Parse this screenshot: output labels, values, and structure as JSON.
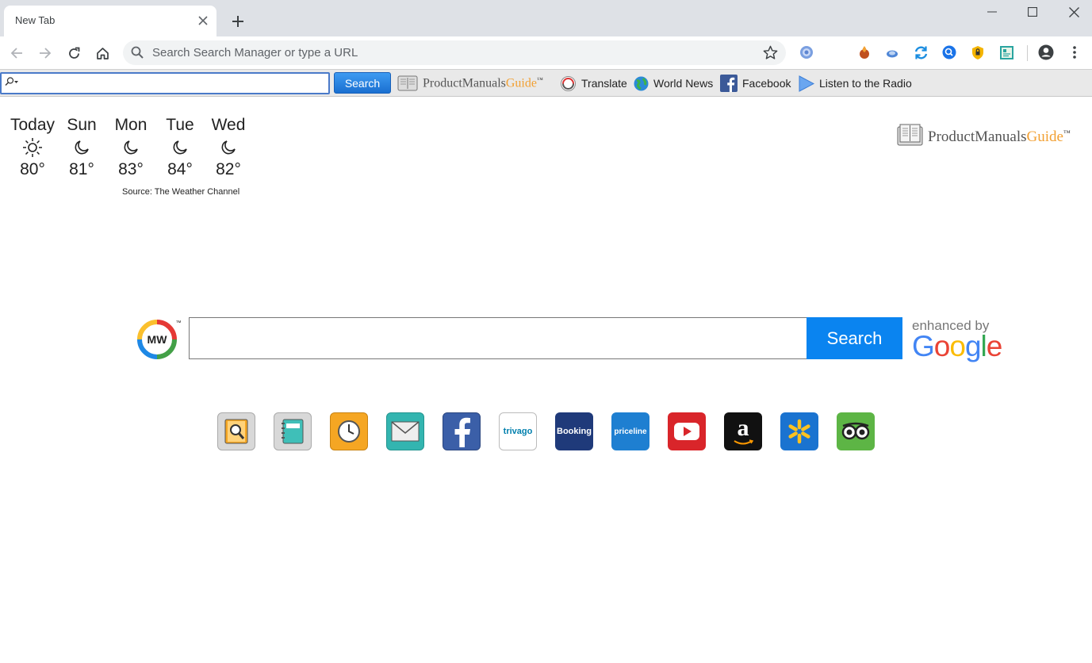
{
  "browser": {
    "tab_title": "New Tab",
    "omnibox_placeholder": "Search Search Manager or type a URL"
  },
  "extension_bar": {
    "search_button": "Search",
    "brand": {
      "main": "ProductManuals",
      "accent": "Guide",
      "tm": "™"
    },
    "links": [
      "Translate",
      "World News",
      "Facebook",
      "Listen to the Radio"
    ]
  },
  "weather": {
    "days": [
      {
        "name": "Today",
        "icon": "sun-icon",
        "temp": "80°"
      },
      {
        "name": "Sun",
        "icon": "moon-icon",
        "temp": "81°"
      },
      {
        "name": "Mon",
        "icon": "moon-icon",
        "temp": "83°"
      },
      {
        "name": "Tue",
        "icon": "moon-icon",
        "temp": "84°"
      },
      {
        "name": "Wed",
        "icon": "moon-icon",
        "temp": "82°"
      }
    ],
    "source": "Source: The Weather Channel"
  },
  "brand_logo": {
    "main": "ProductManuals",
    "accent": "Guide",
    "tm": "™"
  },
  "main_search": {
    "logo_text": "MW",
    "logo_tm": "™",
    "button": "Search",
    "enhanced_label": "enhanced by",
    "enhanced_brand": "Google"
  },
  "tiles": [
    {
      "name": "manuals-search",
      "label": "",
      "bg": "#d8d8d8"
    },
    {
      "name": "notebook",
      "label": "",
      "bg": "#d8d8d8"
    },
    {
      "name": "clock",
      "label": "",
      "bg": "#f5a623"
    },
    {
      "name": "mail",
      "label": "",
      "bg": "#33b5b0"
    },
    {
      "name": "facebook",
      "label": "",
      "bg": "#3b5fa8"
    },
    {
      "name": "trivago",
      "label": "trivago",
      "bg": "#ffffff"
    },
    {
      "name": "booking",
      "label": "Booking",
      "bg": "#1f3a7a"
    },
    {
      "name": "priceline",
      "label": "priceline",
      "bg": "#1e7fd1"
    },
    {
      "name": "youtube",
      "label": "",
      "bg": "#d9252a"
    },
    {
      "name": "amazon",
      "label": "a",
      "bg": "#111111"
    },
    {
      "name": "walmart",
      "label": "",
      "bg": "#1a73d0"
    },
    {
      "name": "tripadvisor",
      "label": "",
      "bg": "#5db545"
    }
  ]
}
